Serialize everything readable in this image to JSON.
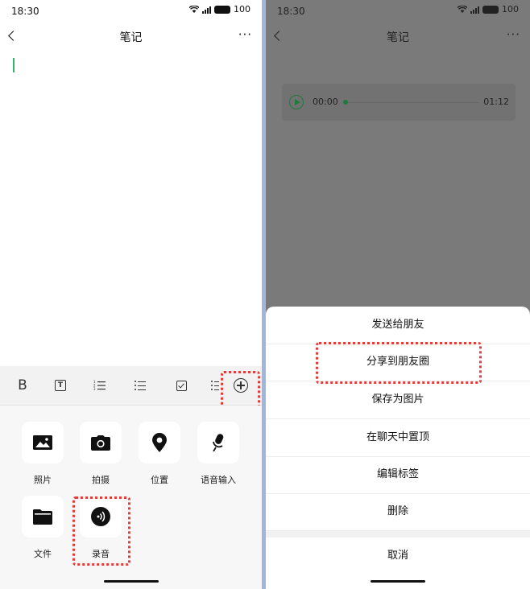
{
  "left": {
    "status": {
      "time": "18:30",
      "battery": "100"
    },
    "nav": {
      "title": "笔记"
    },
    "toolbar": {
      "bold": "B",
      "text_style": "T"
    },
    "attachments": [
      "照片",
      "拍摄",
      "位置",
      "语音输入",
      "文件",
      "录音"
    ]
  },
  "right": {
    "status": {
      "time": "18:30",
      "battery": "100"
    },
    "nav": {
      "title": "笔记"
    },
    "audio": {
      "elapsed": "00:00",
      "duration": "01:12",
      "progress": 0
    },
    "sheet": {
      "items": [
        "发送给朋友",
        "分享到朋友圈",
        "保存为图片",
        "在聊天中置顶",
        "编辑标签",
        "删除"
      ],
      "cancel": "取消"
    }
  },
  "colors": {
    "accent_green": "#2fb66a",
    "highlight_red": "#e53b3b",
    "overlay": "#7a7a7a"
  }
}
